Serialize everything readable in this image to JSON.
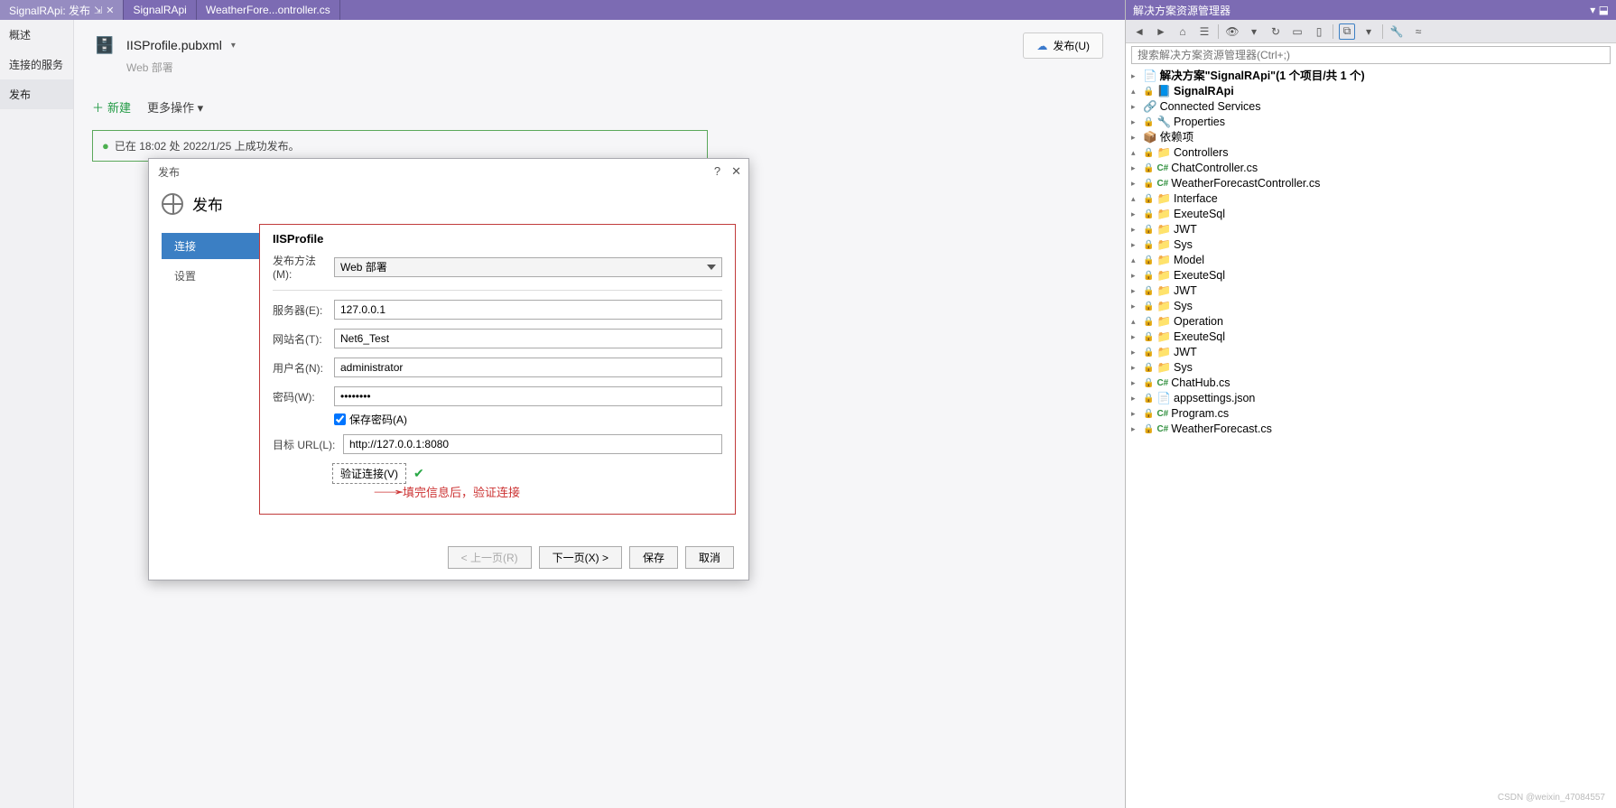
{
  "tabs": {
    "t0": "SignalRApi: 发布",
    "t1": "SignalRApi",
    "t2": "WeatherFore...ontroller.cs"
  },
  "leftnav": {
    "overview": "概述",
    "connected": "连接的服务",
    "publish": "发布"
  },
  "profile": {
    "name": "IISProfile.pubxml",
    "type": "Web 部署",
    "publishBtn": "发布(U)",
    "newBtn": "新建",
    "moreBtn": "更多操作"
  },
  "status": "已在 18:02 处 2022/1/25 上成功发布。",
  "dialog": {
    "title": "发布",
    "heading": "发布",
    "side": {
      "conn": "连接",
      "settings": "设置"
    },
    "section": "IISProfile",
    "labels": {
      "method": "发布方法(M):",
      "server": "服务器(E):",
      "site": "网站名(T):",
      "user": "用户名(N):",
      "pass": "密码(W):",
      "savepass": "保存密码(A)",
      "url": "目标 URL(L):",
      "verify": "验证连接(V)"
    },
    "values": {
      "method": "Web 部署",
      "server": "127.0.0.1",
      "site": "Net6_Test",
      "user": "administrator",
      "pass": "●●●●●●●●",
      "url": "http://127.0.0.1:8080"
    },
    "annot": "填完信息后，验证连接",
    "footer": {
      "prev": "< 上一页(R)",
      "next": "下一页(X) >",
      "save": "保存",
      "cancel": "取消"
    }
  },
  "sx": {
    "title": "解决方案资源管理器",
    "searchPlaceholder": "搜索解决方案资源管理器(Ctrl+;)",
    "solution": "解决方案\"SignalRApi\"(1 个项目/共 1 个)",
    "project": "SignalRApi",
    "nodes": {
      "connected": "Connected Services",
      "properties": "Properties",
      "deps": "依赖项",
      "controllers": "Controllers",
      "chatCtrl": "ChatController.cs",
      "weatherCtrl": "WeatherForecastController.cs",
      "interface": "Interface",
      "exesql": "ExeuteSql",
      "jwt": "JWT",
      "sys": "Sys",
      "model": "Model",
      "operation": "Operation",
      "chathub": "ChatHub.cs",
      "appsettings": "appsettings.json",
      "program": "Program.cs",
      "weatherfc": "WeatherForecast.cs"
    }
  },
  "watermark": "CSDN @weixin_47084557"
}
